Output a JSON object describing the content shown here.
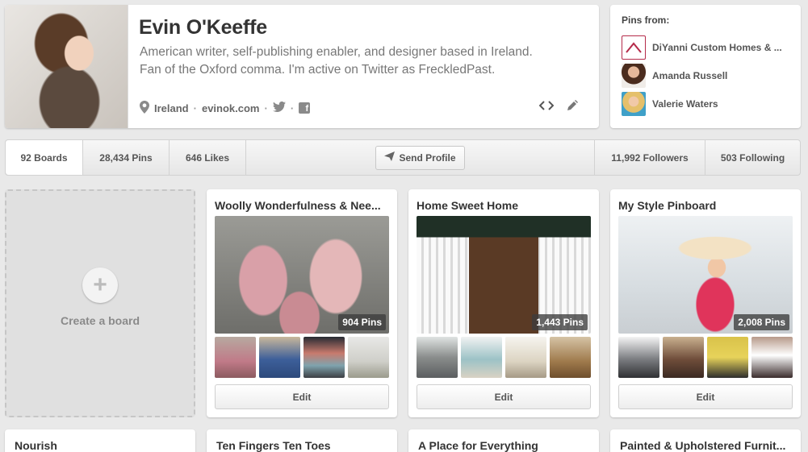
{
  "profile": {
    "name": "Evin O'Keeffe",
    "bio_line1": "American writer, self-publishing enabler, and designer based in Ireland.",
    "bio_line2": "Fan of the Oxford comma. I'm active on Twitter as FreckledPast.",
    "location": "Ireland",
    "website": "evinok.com",
    "separator": "·"
  },
  "pins_from": {
    "title": "Pins from:",
    "items": [
      {
        "name": "DiYanni Custom Homes & ...",
        "thumb_color": "#b52b4a"
      },
      {
        "name": "Amanda Russell",
        "thumb_color": "#7a5038"
      },
      {
        "name": "Valerie Waters",
        "thumb_color": "#d9b07a"
      }
    ]
  },
  "stats": {
    "boards": "92 Boards",
    "pins": "28,434 Pins",
    "likes": "646 Likes",
    "send_profile": "Send Profile",
    "followers": "11,992 Followers",
    "following": "503 Following"
  },
  "create_board": {
    "label": "Create a board"
  },
  "boards": [
    {
      "title": "Woolly Wonderfulness & Nee...",
      "pins": "904 Pins",
      "edit": "Edit"
    },
    {
      "title": "Home Sweet Home",
      "pins": "1,443 Pins",
      "edit": "Edit"
    },
    {
      "title": "My Style Pinboard",
      "pins": "2,008 Pins",
      "edit": "Edit"
    }
  ],
  "boards_row2": [
    {
      "title": "Nourish"
    },
    {
      "title": "Ten Fingers Ten Toes"
    },
    {
      "title": "A Place for Everything"
    },
    {
      "title": "Painted & Upholstered Furnit..."
    }
  ],
  "icons": {
    "location": "map-pin-icon",
    "twitter": "twitter-icon",
    "facebook": "facebook-icon",
    "embed": "embed-code-icon",
    "edit": "pencil-icon",
    "send": "paper-plane-icon",
    "plus": "plus-icon"
  }
}
